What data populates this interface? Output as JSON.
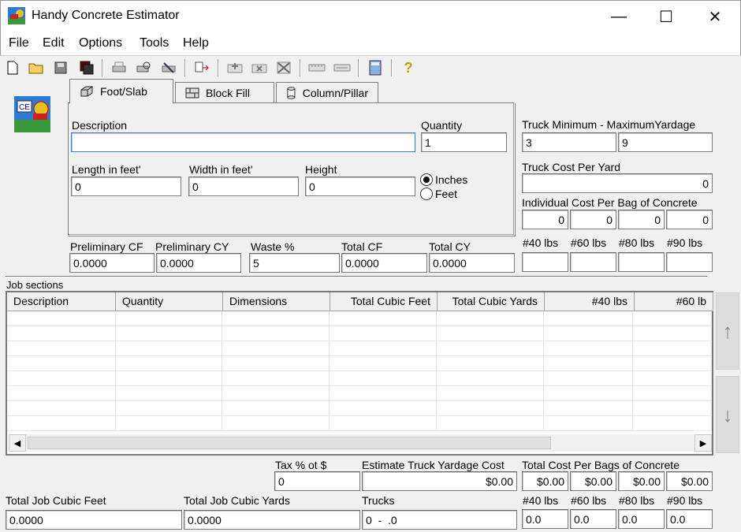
{
  "window": {
    "title": "Handy Concrete Estimator",
    "minimize": "—",
    "maximize": "☐",
    "close": "✕"
  },
  "menu": [
    "File",
    "Edit",
    "Options",
    "Tools",
    "Help"
  ],
  "tabs": [
    {
      "label": "Foot/Slab",
      "icon": "slab-icon"
    },
    {
      "label": "Block Fill",
      "icon": "block-icon"
    },
    {
      "label": "Column/Pillar",
      "icon": "column-icon"
    }
  ],
  "form": {
    "description_label": "Description",
    "description_value": "",
    "quantity_label": "Quantity",
    "quantity_value": "1",
    "length_label": "Length in feet'",
    "length_value": "0",
    "width_label": "Width in feet'",
    "width_value": "0",
    "height_label": "Height",
    "height_value": "0",
    "unit_inches": "Inches",
    "unit_feet": "Feet",
    "unit_selected": "Inches"
  },
  "prelim": {
    "cf_label": "Preliminary CF",
    "cf_value": "0.0000",
    "cy_label": "Preliminary CY",
    "cy_value": "0.0000",
    "waste_label": "Waste %",
    "waste_value": "5",
    "total_cf_label": "Total CF",
    "total_cf_value": "0.0000",
    "total_cy_label": "Total CY",
    "total_cy_value": "0.0000"
  },
  "truck": {
    "minmax_label": "Truck Minimum - MaximumYardage",
    "min_value": "3",
    "max_value": "9",
    "cost_label": "Truck Cost Per Yard",
    "cost_value": "0",
    "bag_cost_label": "Individual Cost Per Bag of Concrete",
    "bag_costs": [
      "0",
      "0",
      "0",
      "0"
    ],
    "bag_sizes": [
      "#40 lbs",
      "#60 lbs",
      "#80 lbs",
      "#90 lbs"
    ],
    "bag_counts": [
      "",
      "",
      "",
      ""
    ]
  },
  "job_sections": {
    "label": "Job sections",
    "columns": [
      "Description",
      "Quantity",
      "Dimensions",
      "Total Cubic Feet",
      "Total Cubic Yards",
      "#40 lbs",
      "#60 lb"
    ]
  },
  "totals": {
    "tax_label": "Tax % ot $",
    "tax_value": "0",
    "truck_cost_label": "Estimate Truck Yardage Cost",
    "truck_cost_value": "$0.00",
    "bags_cost_label": "Total Cost Per Bags of Concrete",
    "bags_cost_values": [
      "$0.00",
      "$0.00",
      "$0.00",
      "$0.00"
    ],
    "job_cf_label": "Total Job Cubic Feet",
    "job_cf_value": "0.0000",
    "job_cy_label": "Total Job Cubic Yards",
    "job_cy_value": "0.0000",
    "trucks_label": "Trucks",
    "trucks_value": "0  -  .0",
    "bag_sizes": [
      "#40 lbs",
      "#60 lbs",
      "#80 lbs",
      "#90 lbs"
    ],
    "bag_totals": [
      "0.0",
      "0.0",
      "0.0",
      "0.0"
    ]
  }
}
